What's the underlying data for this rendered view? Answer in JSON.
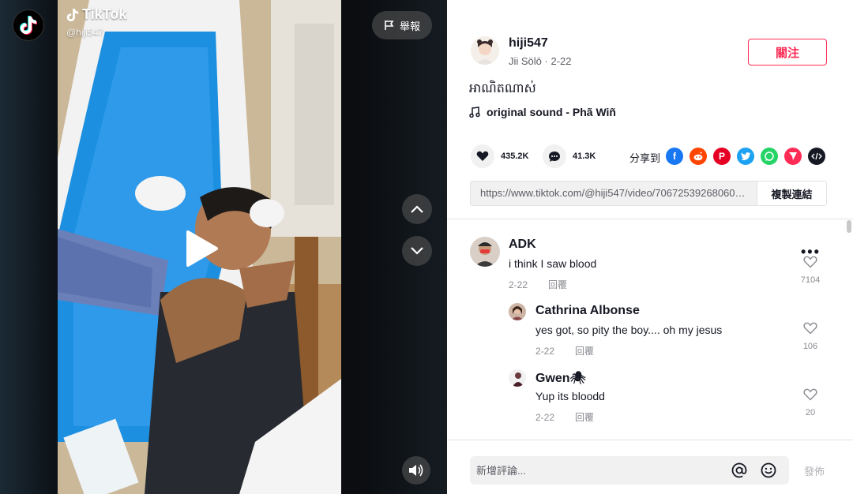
{
  "video": {
    "watermark_brand": "TikTok",
    "watermark_user": "@hiji547",
    "report_label": "舉報"
  },
  "author": {
    "username": "hiji547",
    "nickname": "Jii Sölō",
    "date": "2-22",
    "follow_label": "關注"
  },
  "post": {
    "description": "អាណិតណាស់",
    "music": "original sound - Phã Wiñ"
  },
  "stats": {
    "likes": "435.2K",
    "comments": "41.3K",
    "share_label": "分享到"
  },
  "share_targets": [
    {
      "name": "facebook",
      "color": "#1877f2"
    },
    {
      "name": "reddit",
      "color": "#ff4500"
    },
    {
      "name": "pinterest",
      "color": "#e60023"
    },
    {
      "name": "twitter",
      "color": "#1da1f2"
    },
    {
      "name": "whatsapp",
      "color": "#25d366"
    },
    {
      "name": "telegram",
      "color": "#fe2c55"
    },
    {
      "name": "embed",
      "color": "#161823"
    }
  ],
  "link": {
    "url": "https://www.tiktok.com/@hiji547/video/7067253926806031...",
    "copy_label": "複製連結"
  },
  "comments": [
    {
      "user": "ADK",
      "text": "i think I saw blood",
      "date": "2-22",
      "reply_label": "回覆",
      "likes": "7104"
    },
    {
      "user": "Cathrina Albonse",
      "text": "yes got, so pity the boy.... oh my jesus",
      "date": "2-22",
      "reply_label": "回覆",
      "likes": "106"
    },
    {
      "user": "Gwen🕷",
      "text": "Yup its bloodd",
      "date": "2-22",
      "reply_label": "回覆",
      "likes": "20"
    }
  ],
  "footer": {
    "placeholder": "新增評論...",
    "post_label": "發佈"
  },
  "colors": {
    "accent": "#fe2c55",
    "text": "#161823",
    "muted": "#8a8b91"
  }
}
